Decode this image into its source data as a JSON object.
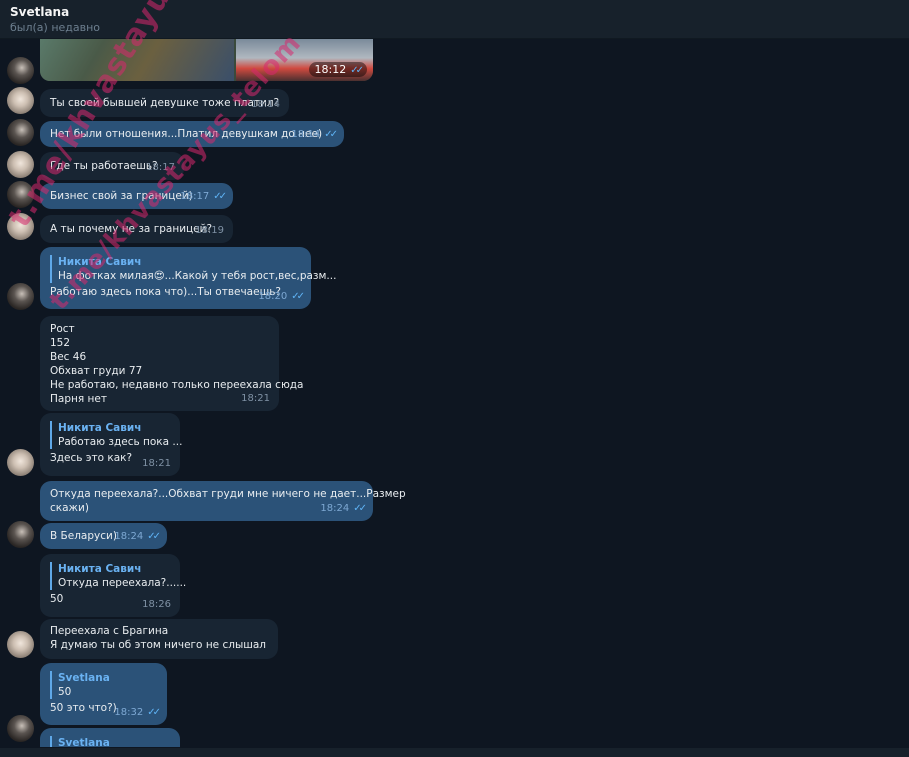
{
  "header": {
    "name": "Svetlana",
    "status": "был(а) недавно"
  },
  "media": {
    "time": "18:12"
  },
  "messages": [
    {
      "text": "Ты своей бывшей девушке тоже платил?",
      "time": "18:14"
    },
    {
      "text": "Нет были отношения...Платил девушкам до нее)",
      "time": "18:14"
    },
    {
      "text": "Где ты работаешь?",
      "time": "18:17"
    },
    {
      "text": "Бизнес свой за границей)",
      "time": "18:17"
    },
    {
      "text": "А ты почему не за границей?",
      "time": "18:19"
    },
    {
      "reply_name": "Никита Савич",
      "reply_text": "На фотках милая😍...Какой у тебя рост,вес,разм...",
      "text": "Работаю здесь пока что)...Ты отвечаешь?",
      "time": "18:20"
    },
    {
      "text": "Рост\n152\nВес 46\nОбхват груди 77\nНе работаю, недавно только переехала сюда\nПарня нет",
      "time": "18:21"
    },
    {
      "reply_name": "Никита Савич",
      "reply_text": "Работаю здесь пока ...",
      "text": "Здесь это как?",
      "time": "18:21"
    },
    {
      "text": "Откуда переехала?...Обхват груди мне ничего не дает...Размер\nскажи)",
      "time": "18:24"
    },
    {
      "text": "В Беларуси)",
      "time": "18:24"
    },
    {
      "reply_name": "Никита Савич",
      "reply_text": "Откуда переехала?......",
      "text": "50",
      "time": "18:26"
    },
    {
      "text": "Переехала с Брагина\nЯ думаю ты об этом ничего не слышал"
    },
    {
      "reply_name": "Svetlana",
      "reply_text": "50",
      "text": "50 это что?)",
      "time": "18:32"
    },
    {
      "reply_name": "Svetlana"
    }
  ],
  "watermark": {
    "text": "t.me/khvastayus_telom",
    "color": "#d7286e"
  },
  "icons": {
    "read_receipt": "double-check-icon"
  }
}
